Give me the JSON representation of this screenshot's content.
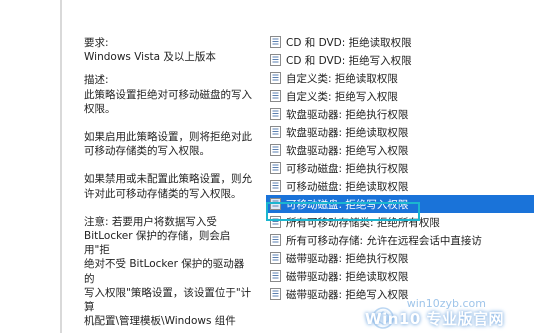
{
  "description": {
    "requirement_title": "要求:",
    "requirement_value": "Windows Vista 及以上版本",
    "desc_title": "描述:",
    "desc_text": "此策略设置拒绝对可移动磁盘的写入\n权限。",
    "enabled_text": "如果启用此策略设置，则将拒绝对此\n可移动存储类的写入权限。",
    "disabled_text": "如果禁用或未配置此策略设置，则允\n许对此可移动存储类的写入权限。",
    "note_text": "注意: 若要用户将数据写入受\nBitLocker 保护的存储，则会启用\"拒\n绝对不受 BitLocker 保护的驱动器的\n写入权限\"策略设置，该设置位于\"计算\n机配置\\管理模板\\Windows 组件"
  },
  "policy_list": [
    {
      "label": "CD 和 DVD: 拒绝读取权限",
      "selected": false
    },
    {
      "label": "CD 和 DVD: 拒绝写入权限",
      "selected": false
    },
    {
      "label": "自定义类: 拒绝读取权限",
      "selected": false
    },
    {
      "label": "自定义类: 拒绝写入权限",
      "selected": false
    },
    {
      "label": "软盘驱动器: 拒绝执行权限",
      "selected": false
    },
    {
      "label": "软盘驱动器: 拒绝读取权限",
      "selected": false
    },
    {
      "label": "软盘驱动器: 拒绝写入权限",
      "selected": false
    },
    {
      "label": "可移动磁盘: 拒绝执行权限",
      "selected": false
    },
    {
      "label": "可移动磁盘: 拒绝读取权限",
      "selected": false
    },
    {
      "label": "可移动磁盘: 拒绝写入权限",
      "selected": true
    },
    {
      "label": "所有可移动存储类: 拒绝所有权限",
      "selected": false
    },
    {
      "label": "所有可移动存储: 允许在远程会话中直接访",
      "selected": false
    },
    {
      "label": "磁带驱动器: 拒绝执行权限",
      "selected": false
    },
    {
      "label": "磁带驱动器: 拒绝读取权限",
      "selected": false
    },
    {
      "label": "磁带驱动器: 拒绝写入权限",
      "selected": false
    }
  ],
  "watermark": {
    "brand": "Win10 专业版官网",
    "url": "win10zyb.com"
  },
  "colors": {
    "selection": "#1a73d9",
    "highlight_frame": "#1bb6cf"
  }
}
